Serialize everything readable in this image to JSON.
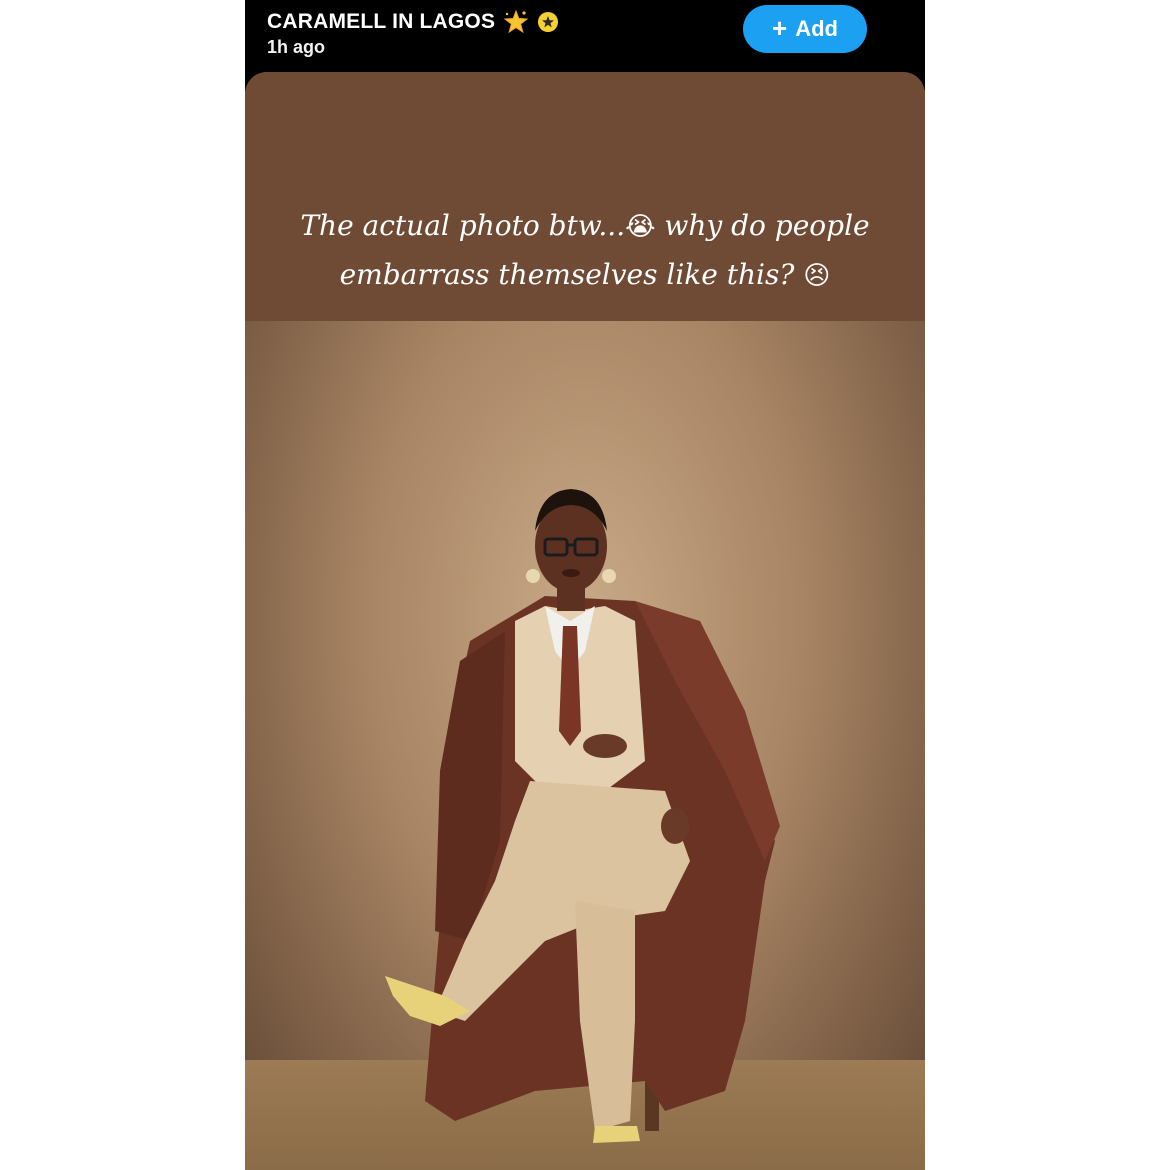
{
  "story": {
    "title": "CARAMELL IN LAGOS",
    "time": "1h ago",
    "add_label": "Add",
    "caption_line1": "The actual photo btw...",
    "caption_line1_emoji": "😭",
    "caption_line1_end": "why do people",
    "caption_line2": "embarrass themselves like this?",
    "caption_line2_emoji": "😣"
  },
  "icons": {
    "title_sparkle": "sparkle-star-icon",
    "title_badge": "gold-star-badge-icon",
    "add": "plus-icon"
  },
  "colors": {
    "header_bg": "#000000",
    "add_button": "#1ca0f2",
    "caption_band": "#6f4b35",
    "text": "#ffffff"
  }
}
